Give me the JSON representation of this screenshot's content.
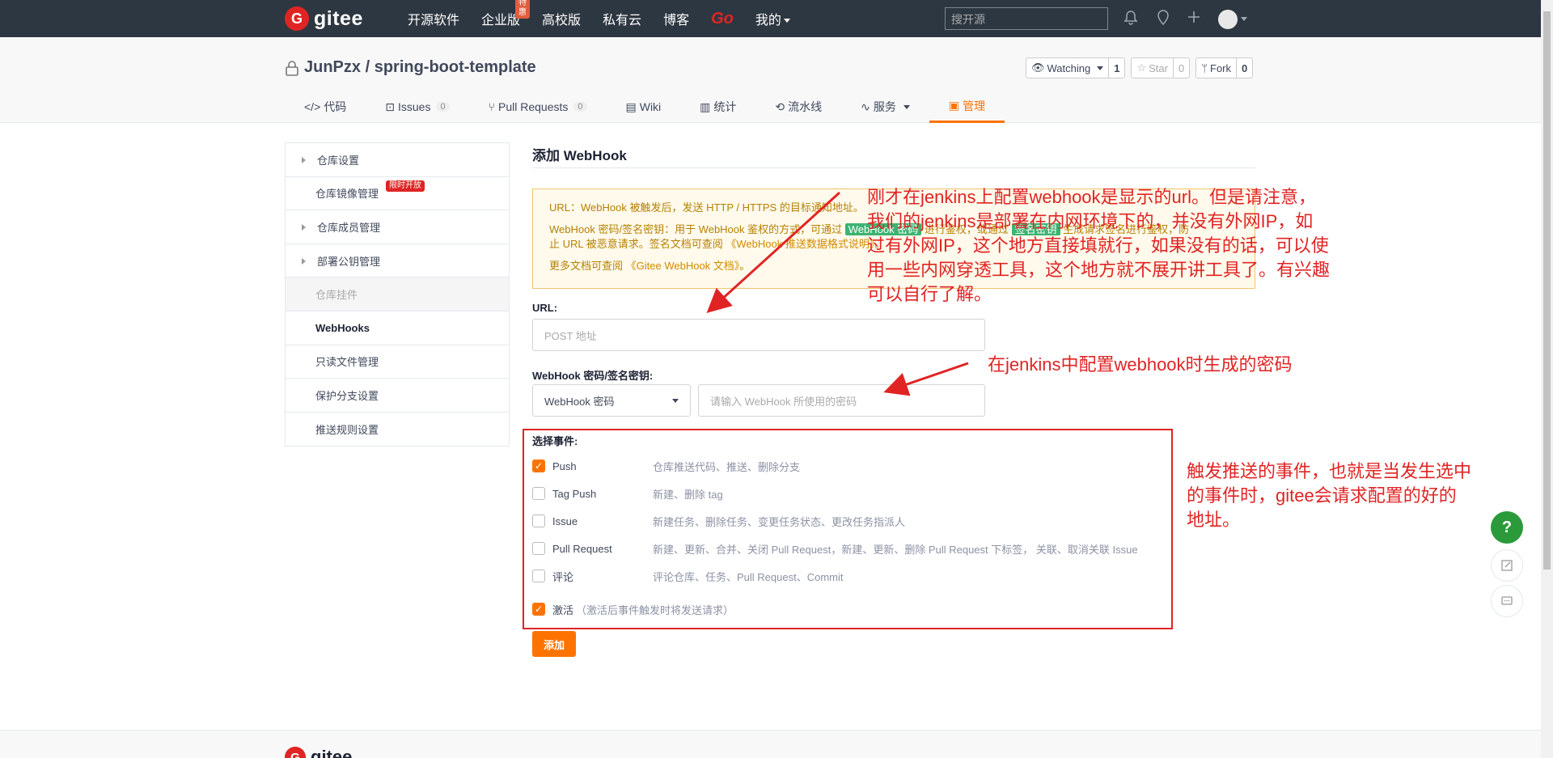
{
  "topnav": {
    "logo_text": "gitee",
    "links": [
      {
        "label": "开源软件"
      },
      {
        "label": "企业版",
        "badge": "特惠"
      },
      {
        "label": "高校版"
      },
      {
        "label": "私有云"
      },
      {
        "label": "博客"
      },
      {
        "label": "Go"
      },
      {
        "label": "我的"
      }
    ],
    "search_placeholder": "搜开源"
  },
  "repo": {
    "title": "JunPzx / spring-boot-template",
    "watch_label": "Watching",
    "watch_count": "1",
    "star_label": "Star",
    "star_count": "0",
    "fork_label": "Fork",
    "fork_count": "0"
  },
  "tabs": [
    {
      "label": "代码"
    },
    {
      "label": "Issues",
      "count": "0"
    },
    {
      "label": "Pull Requests",
      "count": "0"
    },
    {
      "label": "Wiki"
    },
    {
      "label": "统计"
    },
    {
      "label": "流水线"
    },
    {
      "label": "服务"
    },
    {
      "label": "管理"
    }
  ],
  "sidebar": {
    "items": [
      {
        "label": "仓库设置"
      },
      {
        "label": "仓库镜像管理",
        "badge": "限时开放"
      },
      {
        "label": "仓库成员管理"
      },
      {
        "label": "部署公钥管理"
      },
      {
        "label": "仓库挂件"
      },
      {
        "label": "WebHooks"
      },
      {
        "label": "只读文件管理"
      },
      {
        "label": "保护分支设置"
      },
      {
        "label": "推送规则设置"
      }
    ]
  },
  "main": {
    "title": "添加 WebHook",
    "info": {
      "line1": "URL：WebHook 被触发后，发送 HTTP / HTTPS 的目标通知地址。",
      "line2a": "WebHook 密码/签名密钥：用于 WebHook 鉴权的方式，可通过",
      "line2_tag1": "WebHook 密码",
      "line2b": "进行鉴权，或通过",
      "line2_tag2": "签名密钥",
      "line2c": "生成请求签名进行鉴权，防",
      "line3a": "止 URL 被恶意请求。签名文档可查阅",
      "line3_link": "《WebHook 推送数据格式说明》",
      "line3b": "。",
      "line4a": "更多文档可查阅",
      "line4_link": "《Gitee WebHook 文档》",
      "line4b": "。"
    },
    "url_label": "URL:",
    "url_placeholder": "POST 地址",
    "secret_label": "WebHook 密码/签名密钥:",
    "secret_select": "WebHook 密码",
    "secret_placeholder": "请输入 WebHook 所使用的密码",
    "events_label": "选择事件:",
    "events": [
      {
        "name": "Push",
        "desc": "仓库推送代码、推送、删除分支",
        "checked": true
      },
      {
        "name": "Tag Push",
        "desc": "新建、删除 tag",
        "checked": false
      },
      {
        "name": "Issue",
        "desc": "新建任务、删除任务、变更任务状态、更改任务指派人",
        "checked": false
      },
      {
        "name": "Pull Request",
        "desc": "新建、更新、合并、关闭 Pull Request，新建、更新、删除 Pull Request 下标签， 关联、取消关联 Issue",
        "checked": false
      },
      {
        "name": "评论",
        "desc": "评论仓库、任务、Pull Request、Commit",
        "checked": false
      }
    ],
    "activate_label": "激活",
    "activate_hint": "（激活后事件触发时将发送请求）",
    "activate_checked": true,
    "add_button": "添加"
  },
  "annotations": {
    "note1_lines": [
      "刚才在jenkins上配置webhook是显示的url。但是请注意，",
      "我们的jenkins是部署在内网环境下的，并没有外网IP，如",
      "过有外网IP，这个地方直接填就行，如果没有的话，可以使",
      "用一些内网穿透工具，这个地方就不展开讲工具了。有兴趣",
      "可以自行了解。"
    ],
    "note2": "在jenkins中配置webhook时生成的密码",
    "note3_lines": [
      "触发推送的事件，也就是当发生选中",
      "的事件时，gitee会请求配置的好的",
      "地址。"
    ]
  },
  "floating": {
    "help": "?"
  },
  "footer": {
    "logo_text": "gitee"
  },
  "colors": {
    "accent": "#fe7300",
    "annotation": "#e02424",
    "nav_bg": "#2d3741"
  }
}
